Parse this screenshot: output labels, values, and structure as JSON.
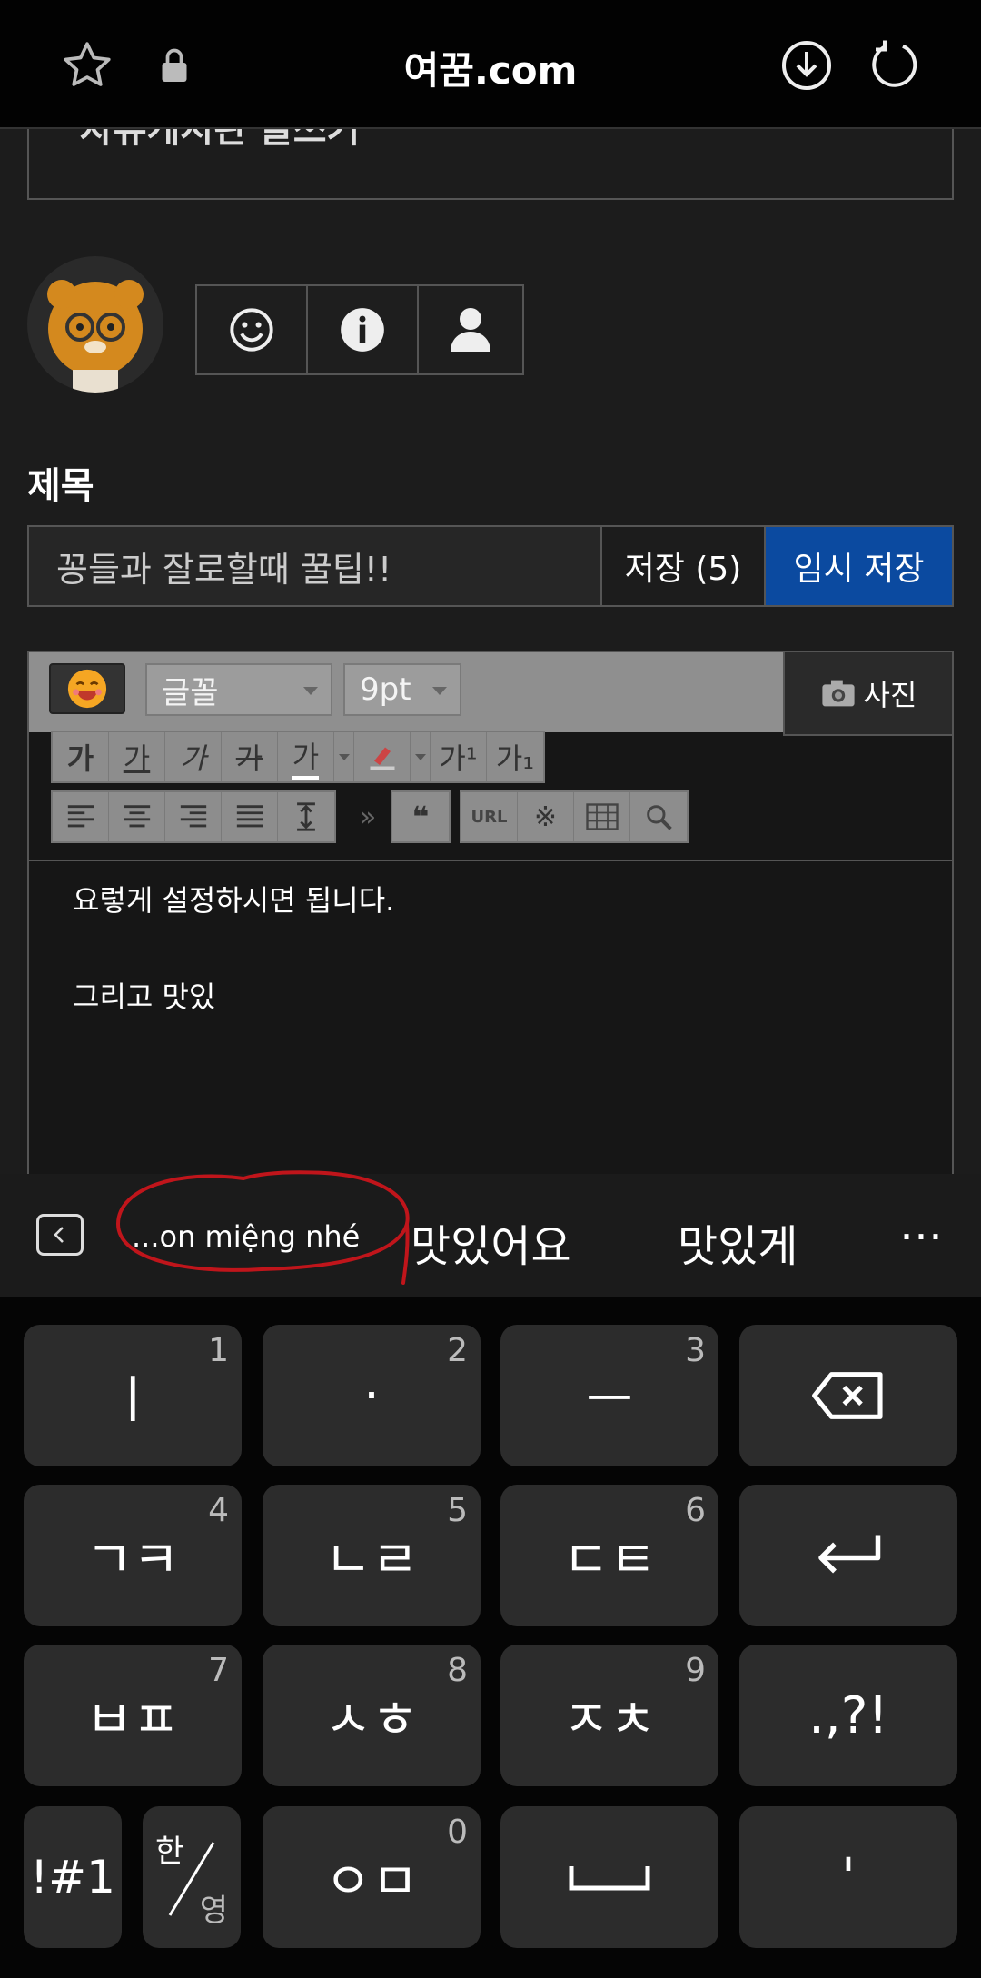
{
  "browser": {
    "url": "여꿈.com"
  },
  "page": {
    "clipped_heading": "자유게시판 글쓰기",
    "title_label": "제목",
    "title_input_value": "꽁들과 잘로할때 꿀팁!!",
    "save_label": "저장 (5)",
    "temp_save_label": "임시 저장"
  },
  "editor": {
    "font_select": "글꼴",
    "size_select": "9pt",
    "photo_label": "사진",
    "format_tools": [
      "가",
      "가",
      "가",
      "가",
      "가",
      "가¹",
      "가₁"
    ],
    "lines": [
      "요렇게 설정하시면 됩니다.",
      "그리고 맛있"
    ],
    "toolbar_more": "»",
    "quote_tool": "❝",
    "url_tool": "URL",
    "special_char_tool": "※"
  },
  "suggestions": {
    "items": [
      "...on miệng nhé",
      "맛있어요",
      "맛있게"
    ],
    "more": "⋯"
  },
  "keyboard": {
    "row1": [
      {
        "label": "ㅣ",
        "num": "1"
      },
      {
        "label": "·",
        "num": "2"
      },
      {
        "label": "ㅡ",
        "num": "3"
      }
    ],
    "row2": [
      {
        "label": "ㄱㅋ",
        "num": "4"
      },
      {
        "label": "ㄴㄹ",
        "num": "5"
      },
      {
        "label": "ㄷㅌ",
        "num": "6"
      }
    ],
    "row3": [
      {
        "label": "ㅂㅍ",
        "num": "7"
      },
      {
        "label": "ㅅㅎ",
        "num": "8"
      },
      {
        "label": "ㅈㅊ",
        "num": "9"
      }
    ],
    "punct": ".,?!",
    "symbols": "!#1",
    "lang_top": "한",
    "lang_bottom": "영",
    "zero": {
      "label": "ㅇㅁ",
      "num": "0"
    },
    "apostrophe": "'"
  },
  "colors": {
    "accent": "#0b4aa0",
    "bg": "#1c1c1c",
    "key": "#2c2c2c",
    "annotation": "#c0151b"
  }
}
